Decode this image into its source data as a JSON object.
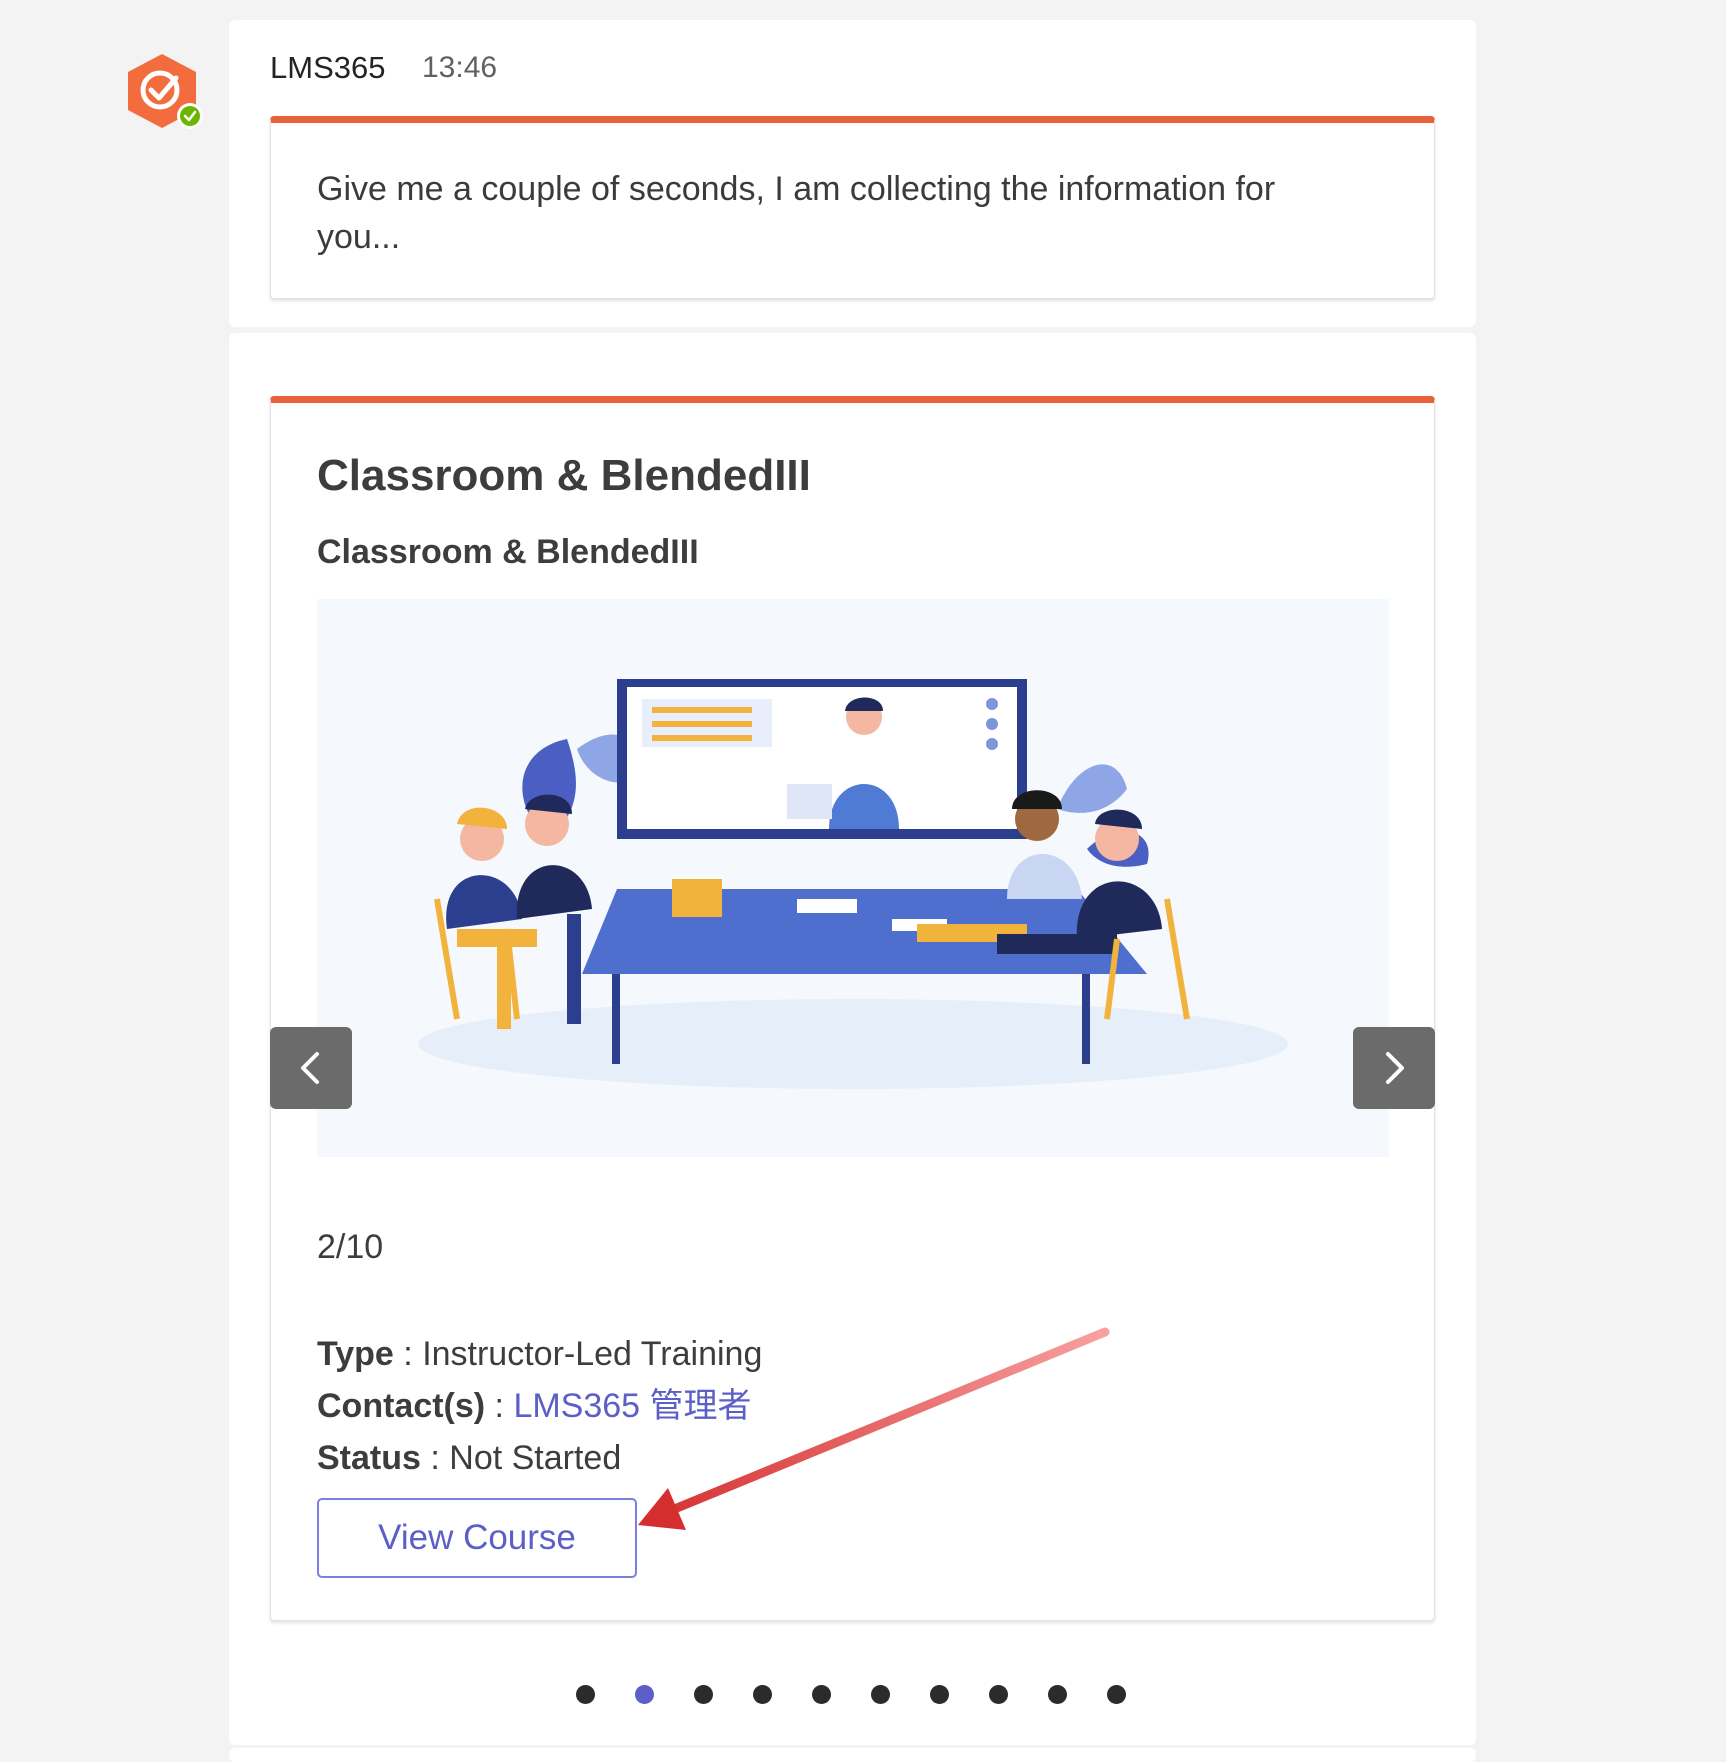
{
  "message": {
    "sender": "LMS365",
    "time": "13:46",
    "text": "Give me a couple of seconds, I am collecting the information for you..."
  },
  "course": {
    "title": "Classroom & BlendedIII",
    "subtitle": "Classroom & BlendedIII",
    "counter": "2/10",
    "type_label": "Type",
    "type_value": "Instructor-Led Training",
    "contact_label": "Contact(s)",
    "contact_value": "LMS365 管理者",
    "status_label": "Status",
    "status_value": "Not Started",
    "view_button": "View Course",
    "separator": " : "
  },
  "carousel": {
    "total": 10,
    "active_index": 1
  },
  "colors": {
    "accent_bar": "#e5623a",
    "link": "#5b5fc7",
    "avatar": "#f36c3d",
    "online": "#6bb700",
    "arrow": "#d42e2e"
  },
  "icons": {
    "avatar": "lms365-logo-icon",
    "presence": "available-check-icon",
    "prev": "chevron-left-icon",
    "next": "chevron-right-icon"
  }
}
